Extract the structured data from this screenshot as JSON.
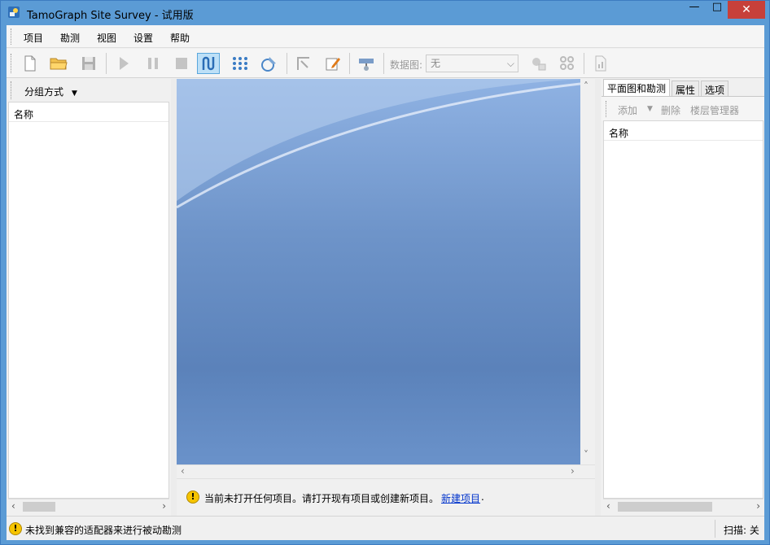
{
  "window": {
    "title": "TamoGraph Site Survey - 试用版",
    "min": "—",
    "max": "□",
    "close": "✕"
  },
  "menu": [
    "项目",
    "勘测",
    "视图",
    "设置",
    "帮助"
  ],
  "toolbar": {
    "data_map_label": "数据图:",
    "data_map_value": "无",
    "icons": [
      "new-file-icon",
      "open-folder-icon",
      "save-icon",
      "play-icon",
      "pause-icon",
      "stop-icon",
      "passive-survey-icon",
      "active-survey-icon",
      "gps-icon",
      "calibrate-icon",
      "edit-icon",
      "ap-icon",
      "data-settings-icon",
      "grid-icon",
      "report-icon"
    ]
  },
  "left_panel": {
    "group_by": "分组方式",
    "column": "名称"
  },
  "message": {
    "text": "当前未打开任何项目。请打开现有项目或创建新项目。",
    "link": "新建项目",
    "suffix": "."
  },
  "right_panel": {
    "tabs": [
      "平面图和勘测",
      "属性",
      "选项"
    ],
    "add": "添加",
    "delete": "删除",
    "floor_manager": "楼层管理器",
    "column": "名称"
  },
  "status": {
    "text": "未找到兼容的适配器来进行被动勘测",
    "scan": "扫描: 关"
  },
  "colors": {
    "title_bg": "#5b9bd5",
    "close_bg": "#c7403a",
    "link": "#0033cc",
    "canvas_top": "#8fb2e3",
    "canvas_bottom": "#5b82ba"
  }
}
